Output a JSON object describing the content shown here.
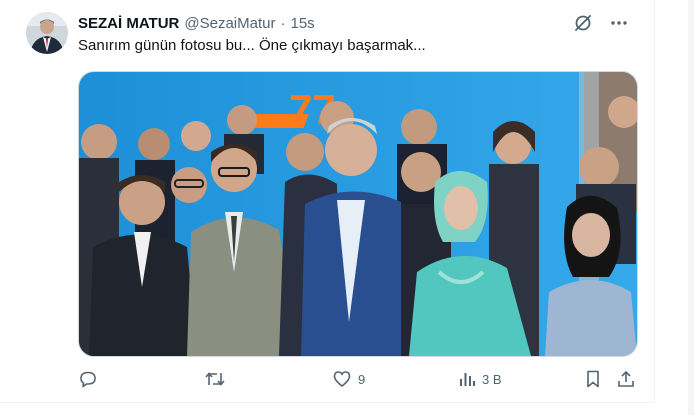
{
  "tweet": {
    "display_name": "SEZAİ MATUR",
    "handle": "@SezaiMatur",
    "separator": "·",
    "time": "15s",
    "text": "Sanırım günün fotosu bu... Öne çıkmayı başarmak...",
    "photo": {
      "banner_text": "77"
    }
  },
  "actions": {
    "reply_count": "",
    "retweet_count": "",
    "like_count": "9",
    "views_count": "3 B"
  },
  "icons": {
    "top": [
      "grok-icon",
      "more-icon"
    ],
    "actions": [
      "reply-icon",
      "retweet-icon",
      "like-icon",
      "views-icon",
      "bookmark-icon",
      "share-icon"
    ]
  },
  "colors": {
    "text_primary": "#0f1419",
    "text_secondary": "#536471",
    "photo_backdrop": "#1a8fd6",
    "banner_orange": "#ff7a1a"
  }
}
